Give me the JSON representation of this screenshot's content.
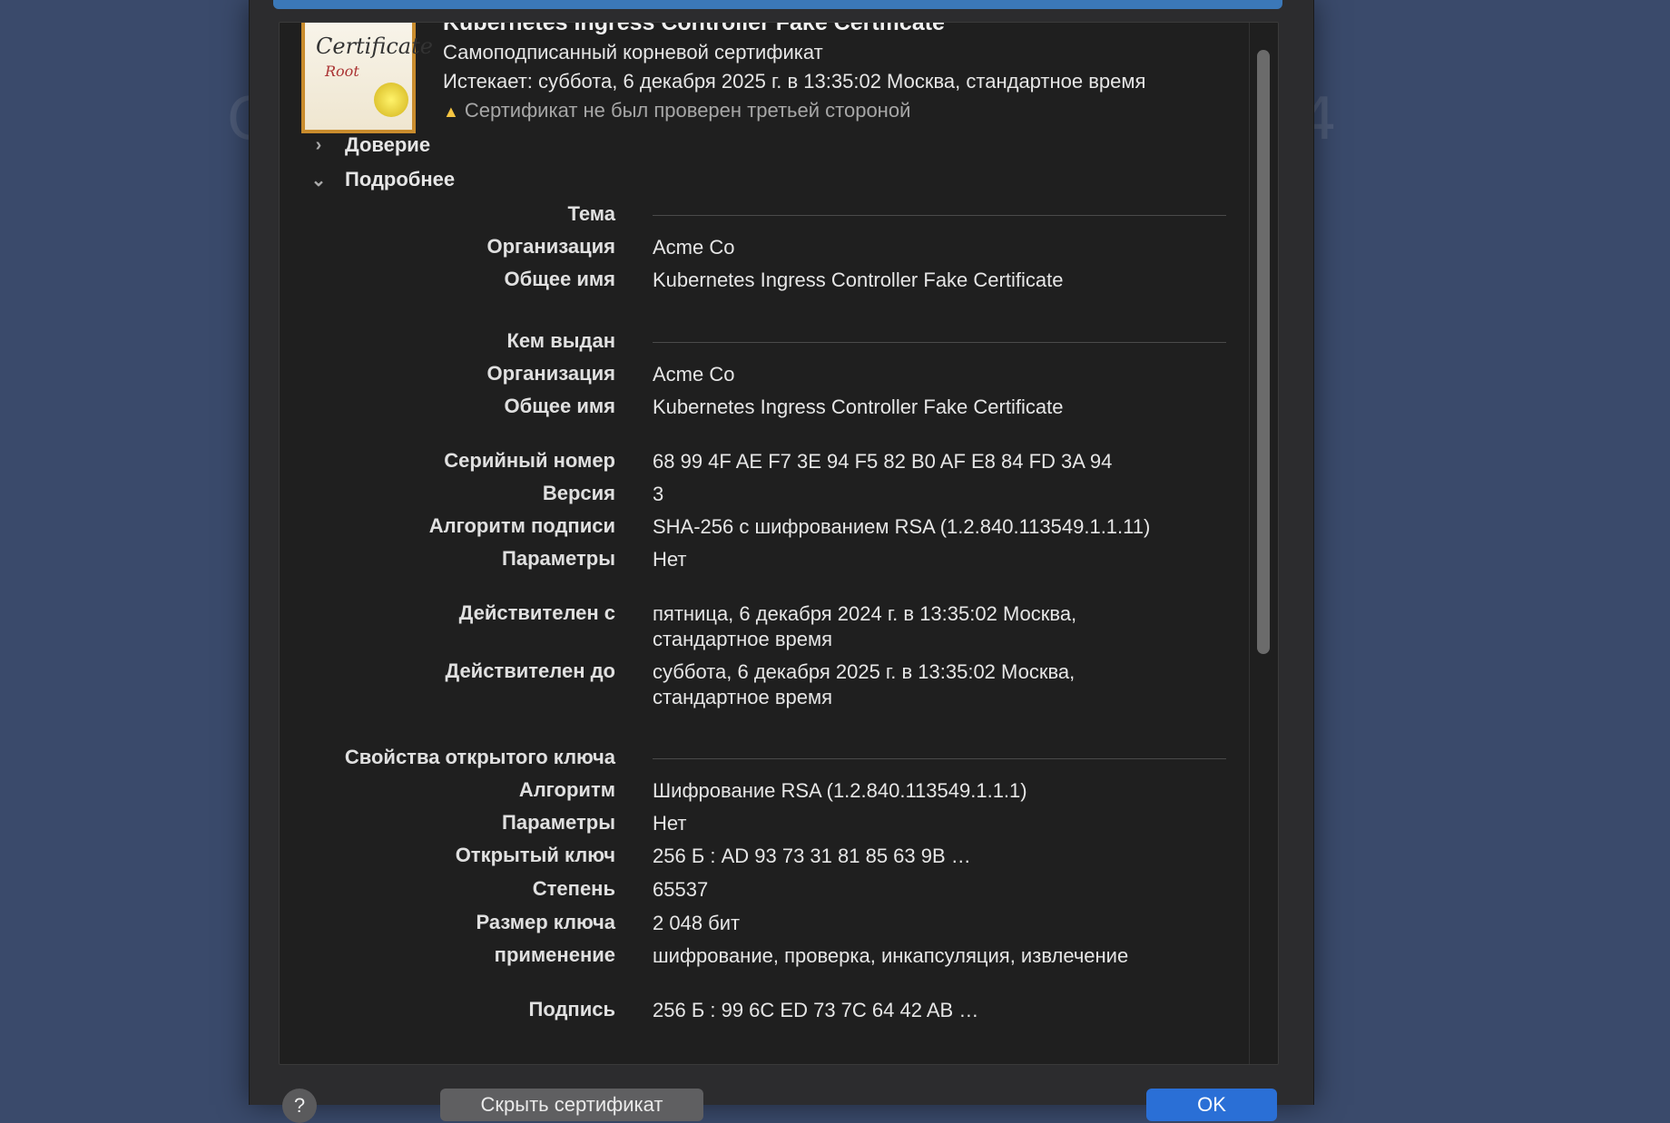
{
  "background": {
    "left_glyph": "C",
    "right_glyph": "4"
  },
  "certificate": {
    "image_text": "Certificate",
    "image_subtext": "Root",
    "title": "Kubernetes Ingress Controller Fake Certificate",
    "type": "Самоподписанный корневой сертификат",
    "expires": "Истекает: суббота, 6 декабря 2025 г. в 13:35:02 Москва, стандартное время",
    "warning": "Сертификат не был проверен третьей стороной"
  },
  "sections": {
    "trust": "Доверие",
    "details": "Подробнее"
  },
  "details": {
    "subject": {
      "header": "Тема",
      "org_label": "Организация",
      "org_value": "Acme Co",
      "cn_label": "Общее имя",
      "cn_value": "Kubernetes Ingress Controller Fake Certificate"
    },
    "issuer": {
      "header": "Кем выдан",
      "org_label": "Организация",
      "org_value": "Acme Co",
      "cn_label": "Общее имя",
      "cn_value": "Kubernetes Ingress Controller Fake Certificate"
    },
    "serial_label": "Серийный номер",
    "serial_value": "68 99 4F AE F7 3E 94 F5 82 B0 AF E8 84 FD 3A 94",
    "version_label": "Версия",
    "version_value": "3",
    "sigalg_label": "Алгоритм подписи",
    "sigalg_value": "SHA-256 с шифрованием RSA (1.2.840.113549.1.1.11)",
    "params_label": "Параметры",
    "params_value": "Нет",
    "valid_from_label": "Действителен с",
    "valid_from_line1": "пятница, 6 декабря 2024 г. в 13:35:02 Москва,",
    "valid_from_line2": "стандартное время",
    "valid_to_label": "Действителен до",
    "valid_to_line1": "суббота, 6 декабря 2025 г. в 13:35:02 Москва,",
    "valid_to_line2": "стандартное время",
    "pubkey": {
      "header": "Свойства открытого ключа",
      "alg_label": "Алгоритм",
      "alg_value": "Шифрование RSA (1.2.840.113549.1.1.1)",
      "params_label": "Параметры",
      "params_value": "Нет",
      "key_label": "Открытый ключ",
      "key_value": "256 Б : AD 93 73 31 81 85 63 9B …",
      "exp_label": "Степень",
      "exp_value": "65537",
      "size_label": "Размер ключа",
      "size_value": "2 048 бит",
      "usage_label": "применение",
      "usage_value": "шифрование, проверка, инкапсуляция, извлечение"
    },
    "signature_label": "Подпись",
    "signature_value": "256 Б : 99 6C ED 73 7C 64 42 AB …"
  },
  "buttons": {
    "help": "?",
    "hide": "Скрыть сертификат",
    "ok": "OK"
  }
}
